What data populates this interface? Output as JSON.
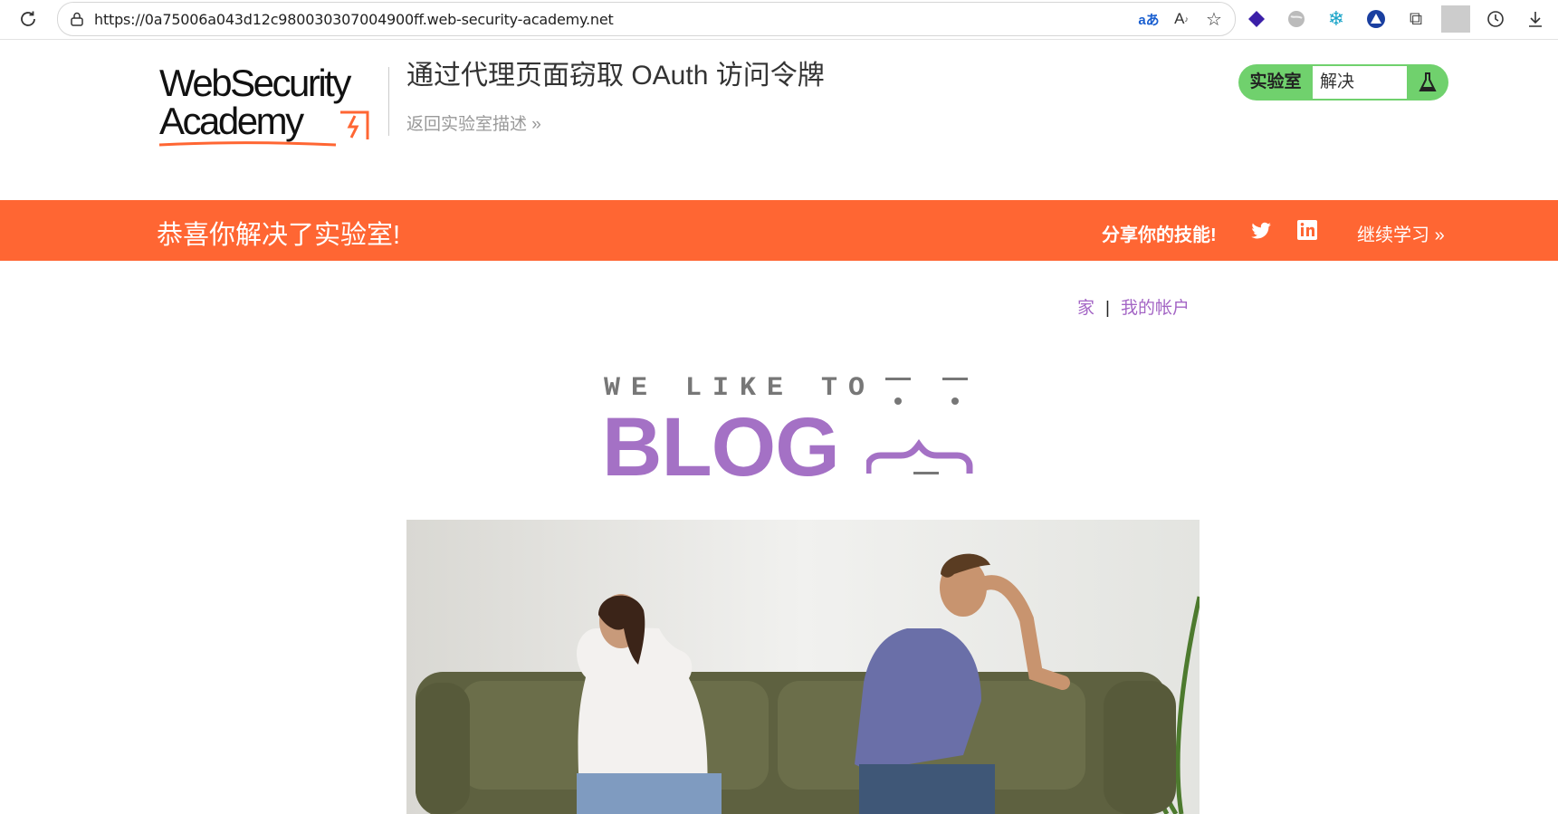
{
  "browser": {
    "url": "https://0a75006a043d12c980030307004900ff.web-security-academy.net",
    "extensions": [
      "extension-purple-icon",
      "extension-globe-icon",
      "extension-snowflake-icon",
      "extension-triangle-icon",
      "extensions-puzzle-icon"
    ]
  },
  "header": {
    "logo_line1": "WebSecurity",
    "logo_line2": "Academy",
    "lab_title": "通过代理页面窃取 OAuth 访问令牌",
    "back_link": "返回实验室描述",
    "lab_status_label": "实验室",
    "lab_status_value": "解决"
  },
  "banner": {
    "message": "恭喜你解决了实验室!",
    "share_text": "分享你的技能!",
    "continue_link": "继续学习"
  },
  "nav": {
    "home": "家",
    "separator": "|",
    "account": "我的帐户"
  },
  "blog_logo": {
    "tagline": "WE LIKE TO",
    "word": "BLOG"
  },
  "colors": {
    "accent_orange": "#ff6633",
    "status_green": "#70d16d",
    "link_purple": "#a466c5"
  }
}
